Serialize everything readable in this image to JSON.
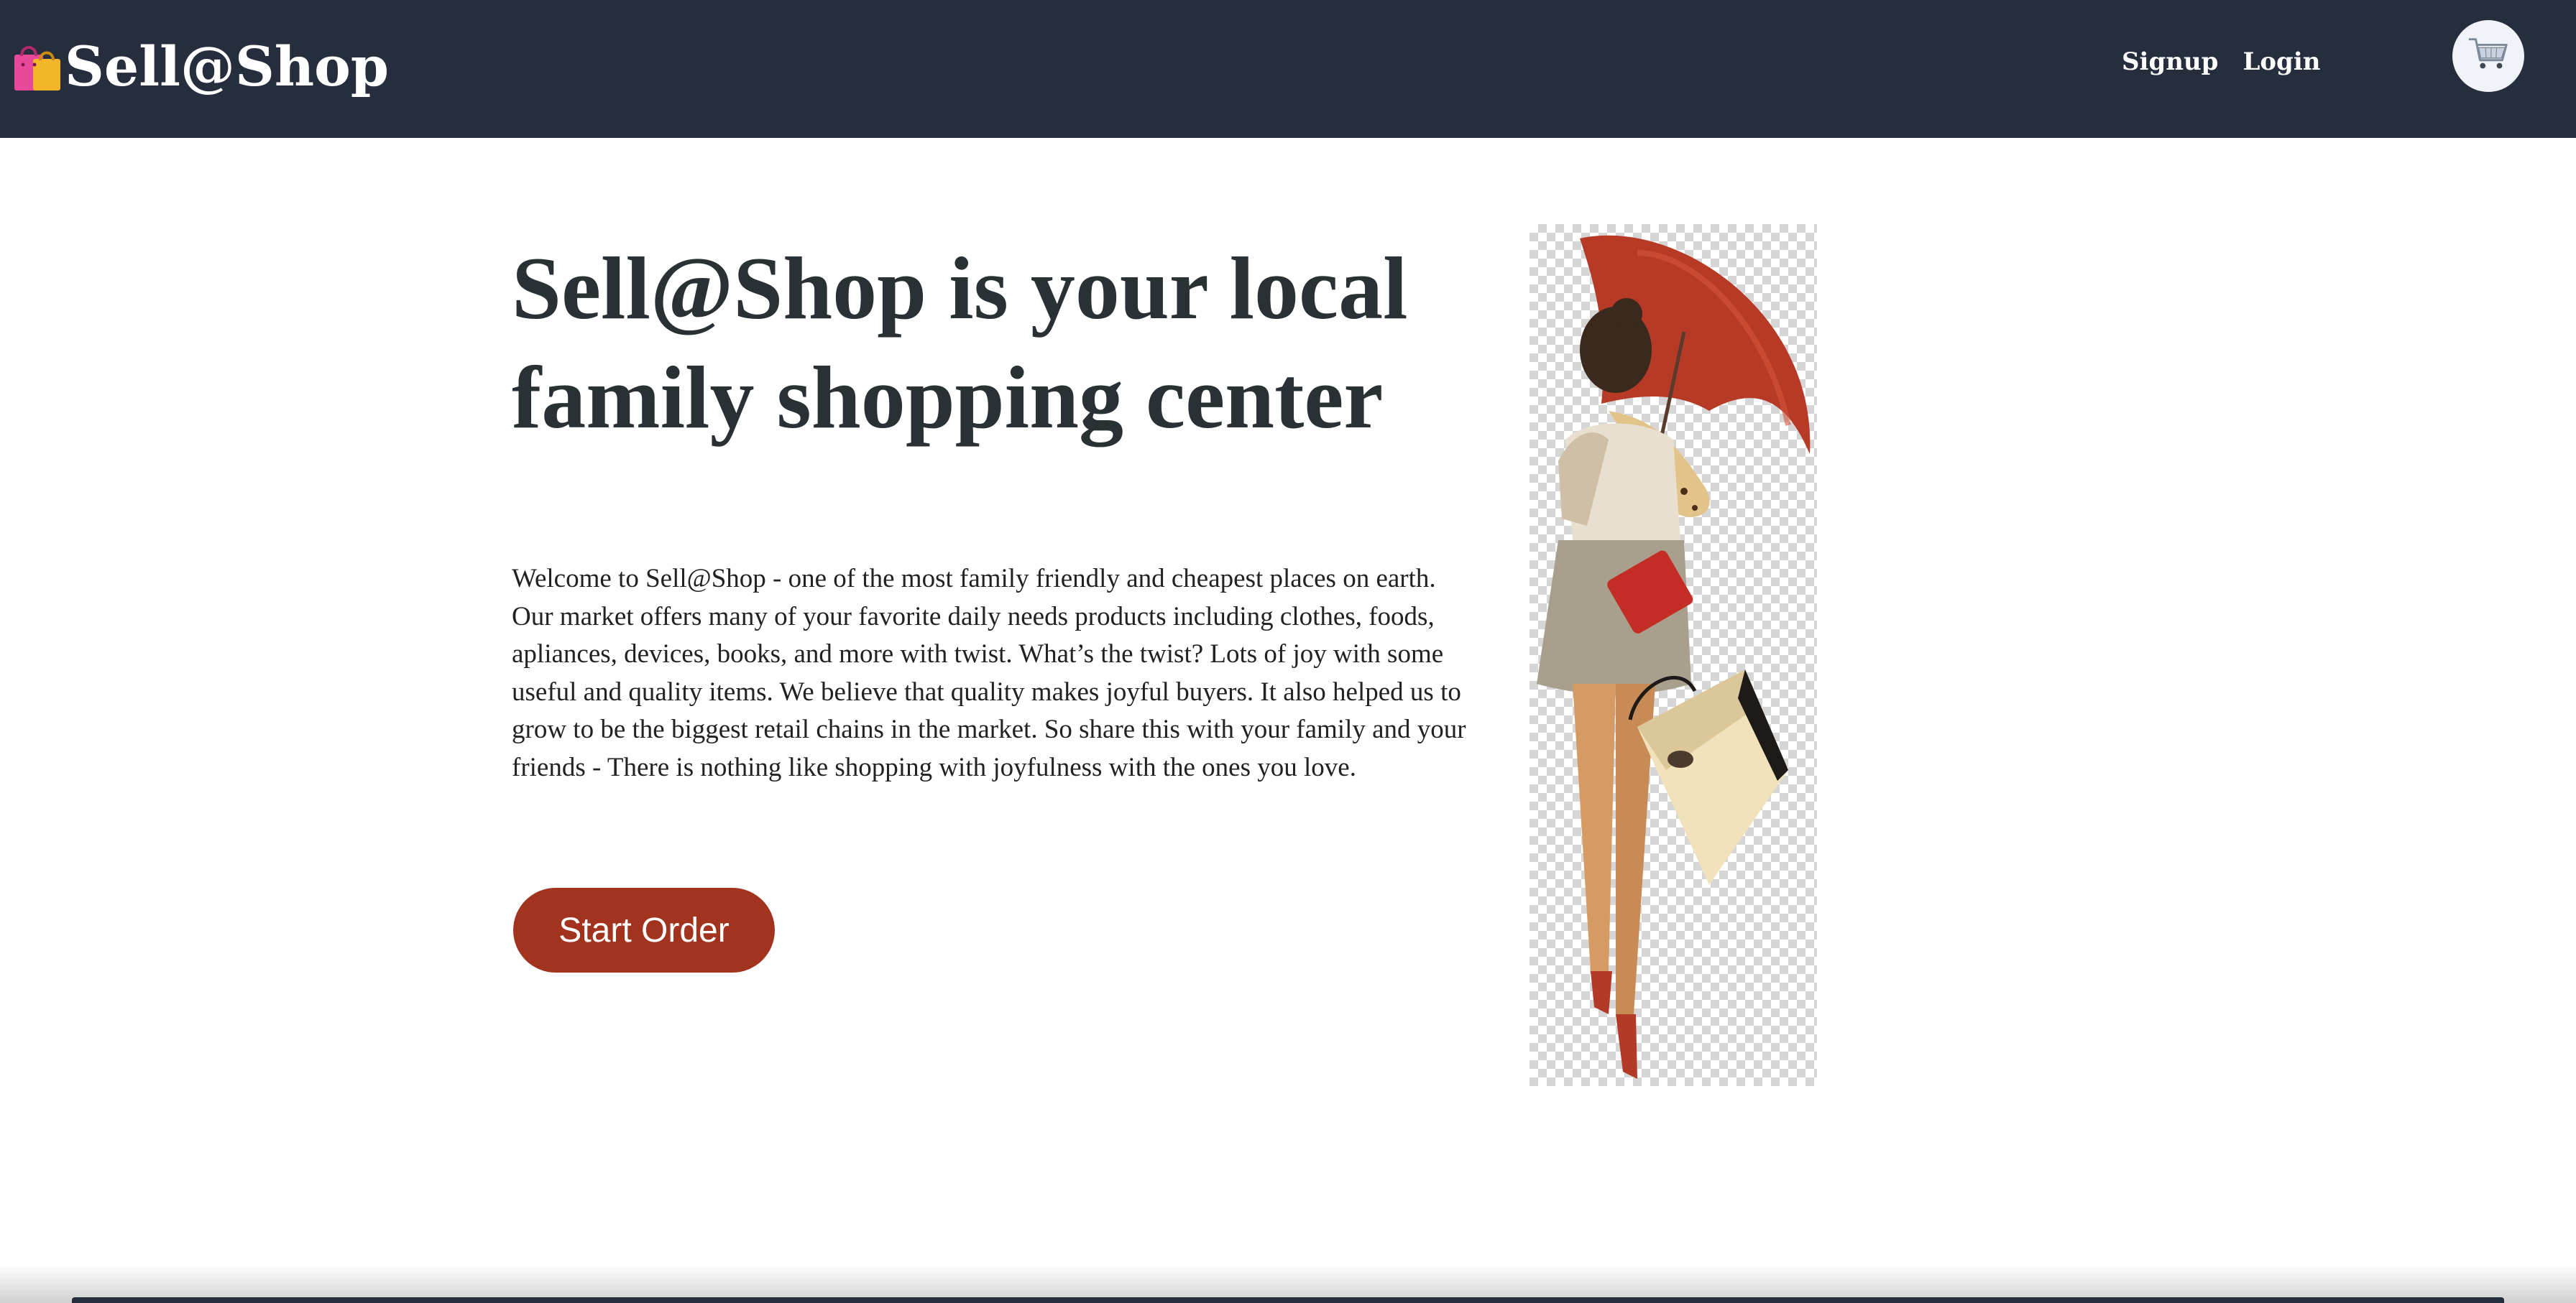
{
  "nav": {
    "brand": "Sell@Shop",
    "brand_icon": "shopping-bags-icon",
    "links": [
      "Signup",
      "Login"
    ],
    "cart_icon": "shopping-cart-icon"
  },
  "hero": {
    "title": "Sell@Shop is your local family shopping center",
    "text": "Welcome to Sell@Shop - one of the most family friendly and cheapest places on earth. Our market offers many of your favorite daily needs products including clothes, foods, apliances, devices, books, and more with twist. What’s the twist? Lots of joy with some useful and quality items. We believe that quality makes joyful buyers. It also helped us to grow to be the biggest retail chains in the market. So share this with your family and your friends - There is nothing like shopping with joyfulness with the ones you love.",
    "cta": "Start Order",
    "image": "woman-with-umbrella-and-shopping-bag-illustration"
  },
  "colors": {
    "navbar": "#262e3d",
    "cta": "#a2341f",
    "title": "#2a3135"
  }
}
